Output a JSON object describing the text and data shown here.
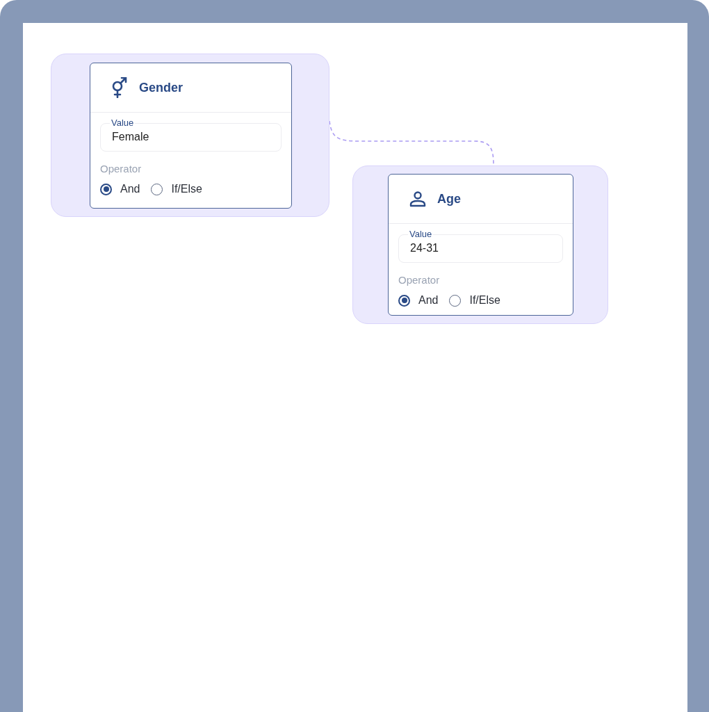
{
  "nodes": [
    {
      "title": "Gender",
      "field": {
        "label": "Value",
        "value": "Female"
      },
      "operator_label": "Operator",
      "operators": [
        {
          "label": "And",
          "selected": true
        },
        {
          "label": "If/Else",
          "selected": false
        }
      ]
    },
    {
      "title": "Age",
      "field": {
        "label": "Value",
        "value": "24-31"
      },
      "operator_label": "Operator",
      "operators": [
        {
          "label": "And",
          "selected": true
        },
        {
          "label": "If/Else",
          "selected": false
        }
      ]
    }
  ]
}
